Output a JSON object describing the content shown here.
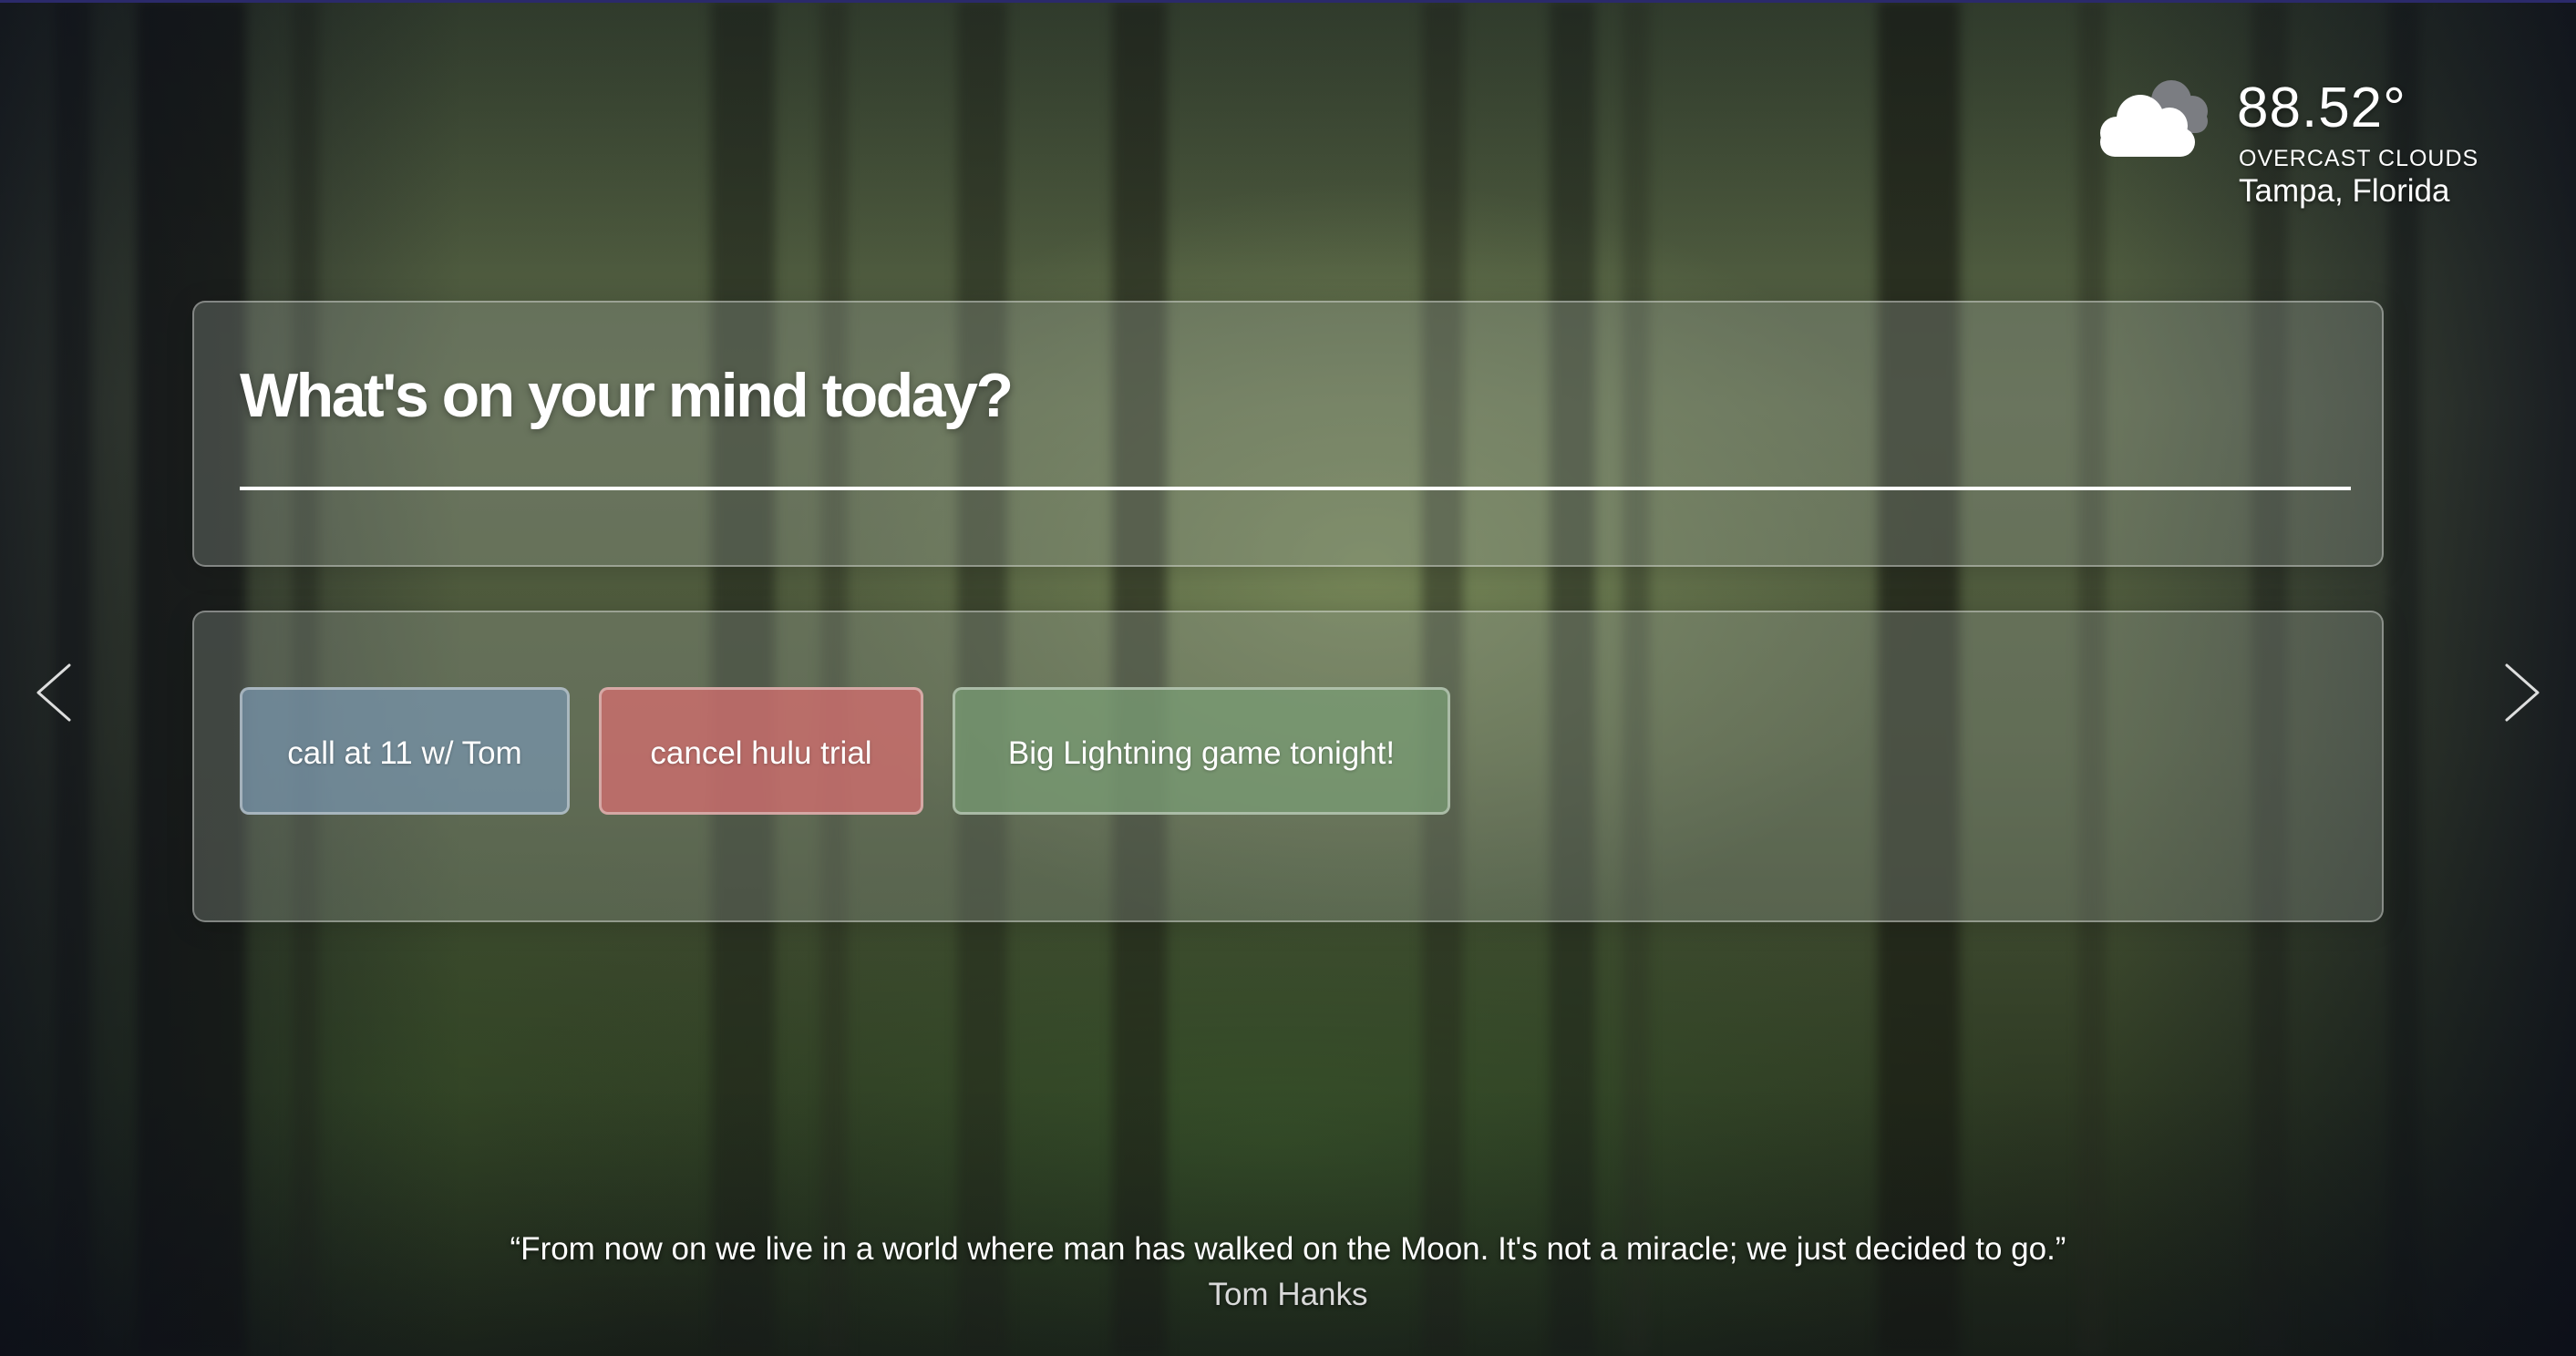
{
  "weather": {
    "icon": "cloud-icon",
    "temperature": "88.52°",
    "condition": "OVERCAST CLOUDS",
    "location": "Tampa, Florida"
  },
  "mind": {
    "prompt": "What's on your mind today?",
    "input_value": ""
  },
  "notes": {
    "items": [
      {
        "label": "call at 11 w/ Tom",
        "color": "#7896af"
      },
      {
        "label": "cancel hulu trial",
        "color": "#cd6e6e"
      },
      {
        "label": "Big Lightning game tonight!",
        "color": "#789b73"
      }
    ]
  },
  "navigation": {
    "prev_icon": "chevron-left-icon",
    "next_icon": "chevron-right-icon"
  },
  "quote": {
    "text": "“From now on we live in a world where man has walked on the Moon. It's not a miracle; we just decided to go.”",
    "author": "Tom Hanks"
  },
  "colors": {
    "panel_background": "#a0a8a0",
    "text": "#ffffff",
    "top_border": "#2b2a6b"
  }
}
